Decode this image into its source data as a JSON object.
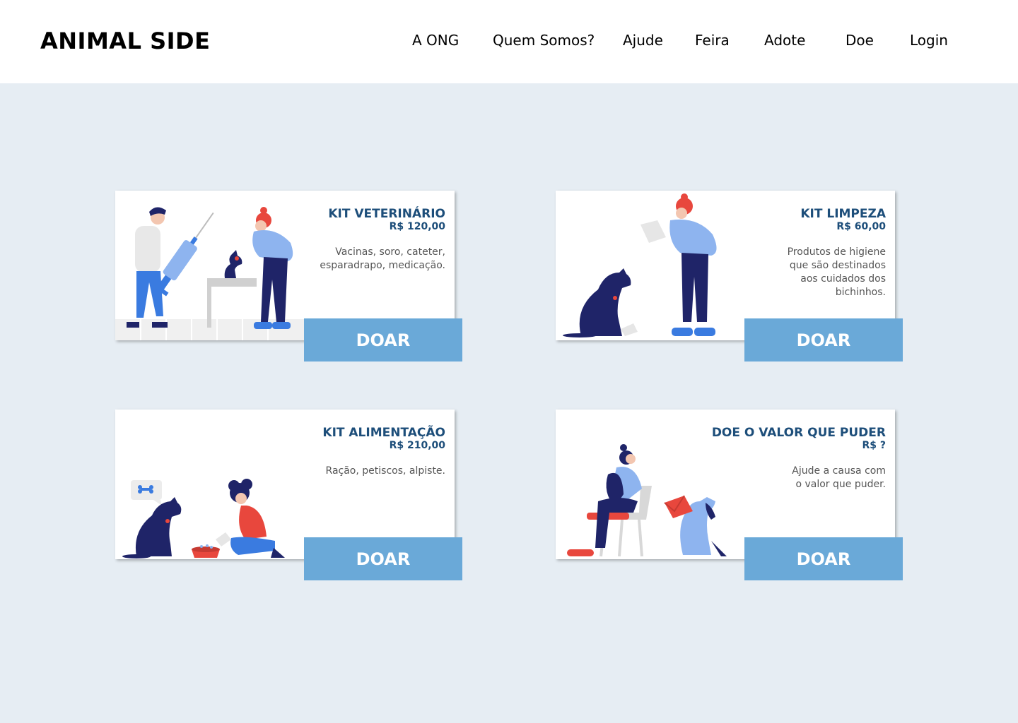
{
  "brand": {
    "logo": "ANIMAL SIDE"
  },
  "nav": {
    "a_ong": "A ONG",
    "quem_somos": "Quem Somos?",
    "ajude": "Ajude",
    "feira": "Feira",
    "adote": "Adote",
    "doe": "Doe",
    "login": "Login"
  },
  "cards": [
    {
      "title": "KIT VETERINÁRIO",
      "price": "R$ 120,00",
      "desc": [
        "Vacinas, soro, cateter,",
        "esparadrapo, medicação."
      ],
      "button": "DOAR"
    },
    {
      "title": "KIT LIMPEZA",
      "price": "R$ 60,00",
      "desc": [
        "Produtos de higiene",
        "que são destinados",
        "aos cuidados dos",
        "bichinhos."
      ],
      "button": "DOAR"
    },
    {
      "title": "KIT ALIMENTAÇÃO",
      "price": "R$ 210,00",
      "desc": [
        "Ração, petiscos, alpiste."
      ],
      "button": "DOAR"
    },
    {
      "title": "DOE O VALOR QUE PUDER",
      "price": "R$ ?",
      "desc": [
        "Ajude a causa com",
        "o valor que puder."
      ],
      "button": "DOAR"
    }
  ],
  "colors": {
    "background": "#e6edf3",
    "title": "#1d4e7a",
    "button": "#6aa9d8",
    "navy": "#1f2468",
    "blue": "#3a7be0",
    "light_blue": "#8eb4ef",
    "red": "#e8473d"
  },
  "icons": [
    "vet-illustration",
    "cleaning-illustration",
    "feeding-illustration",
    "donation-illustration"
  ]
}
